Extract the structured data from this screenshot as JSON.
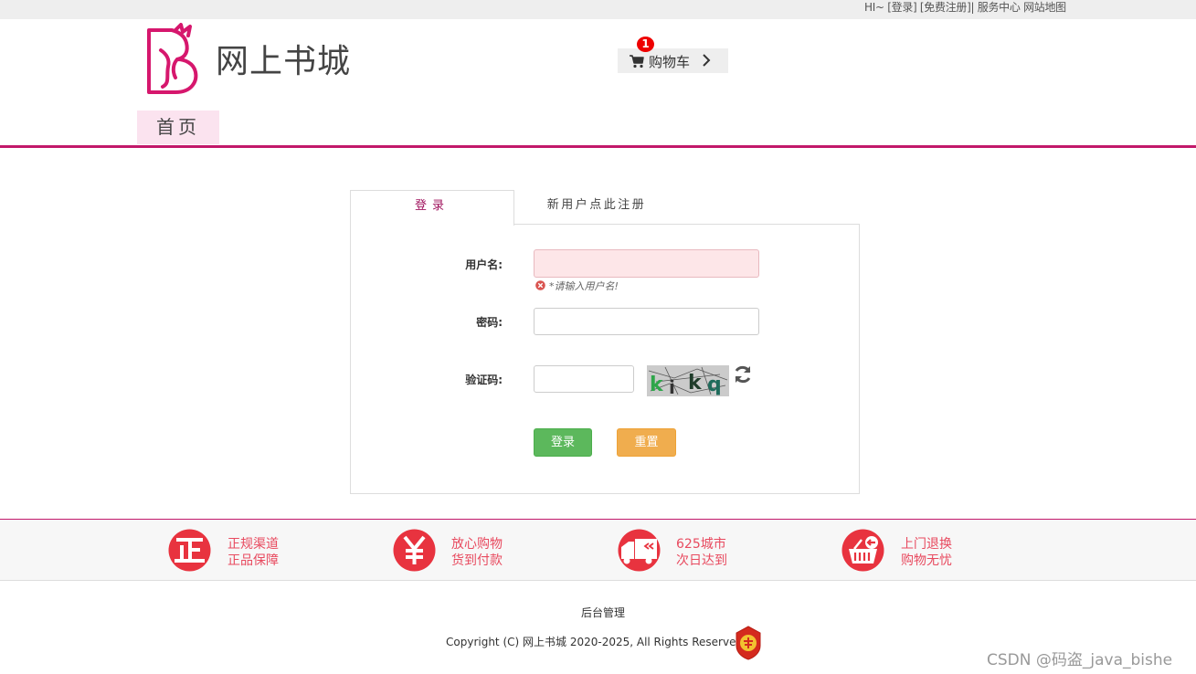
{
  "topbar": {
    "greeting": "HI~",
    "login_link": "[登录]",
    "register_link": "[免费注册]|",
    "service_link": "服务中心",
    "sitemap_link": "网站地图"
  },
  "header": {
    "site_name": "网上书城",
    "cart_label": "购物车",
    "cart_count": "1"
  },
  "nav": {
    "home": "首页"
  },
  "tabs": {
    "login": "登录",
    "register": "新用户点此注册"
  },
  "form": {
    "username_label": "用户名:",
    "username_error": "*请输入用户名!",
    "password_label": "密码:",
    "captcha_label": "验证码:",
    "captcha_text": "kikq",
    "login_button": "登录",
    "reset_button": "重置"
  },
  "features": [
    {
      "icon": "genuine-icon",
      "line1": "正规渠道",
      "line2": "正品保障"
    },
    {
      "icon": "yuan-icon",
      "line1": "放心购物",
      "line2": "货到付款"
    },
    {
      "icon": "truck-icon",
      "line1": "625城市",
      "line2": "次日达到"
    },
    {
      "icon": "basket-icon",
      "line1": "上门退换",
      "line2": "购物无忧"
    }
  ],
  "footer": {
    "admin_link": "后台管理",
    "copyright": "Copyright (C) 网上书城 2020-2025, All Rights Reserved",
    "watermark": "CSDN @码盗_java_bishe"
  },
  "colors": {
    "brand": "#c2186a",
    "feature_red": "#e8333f",
    "login_green": "#5cb85c",
    "reset_orange": "#f0ad4e"
  }
}
